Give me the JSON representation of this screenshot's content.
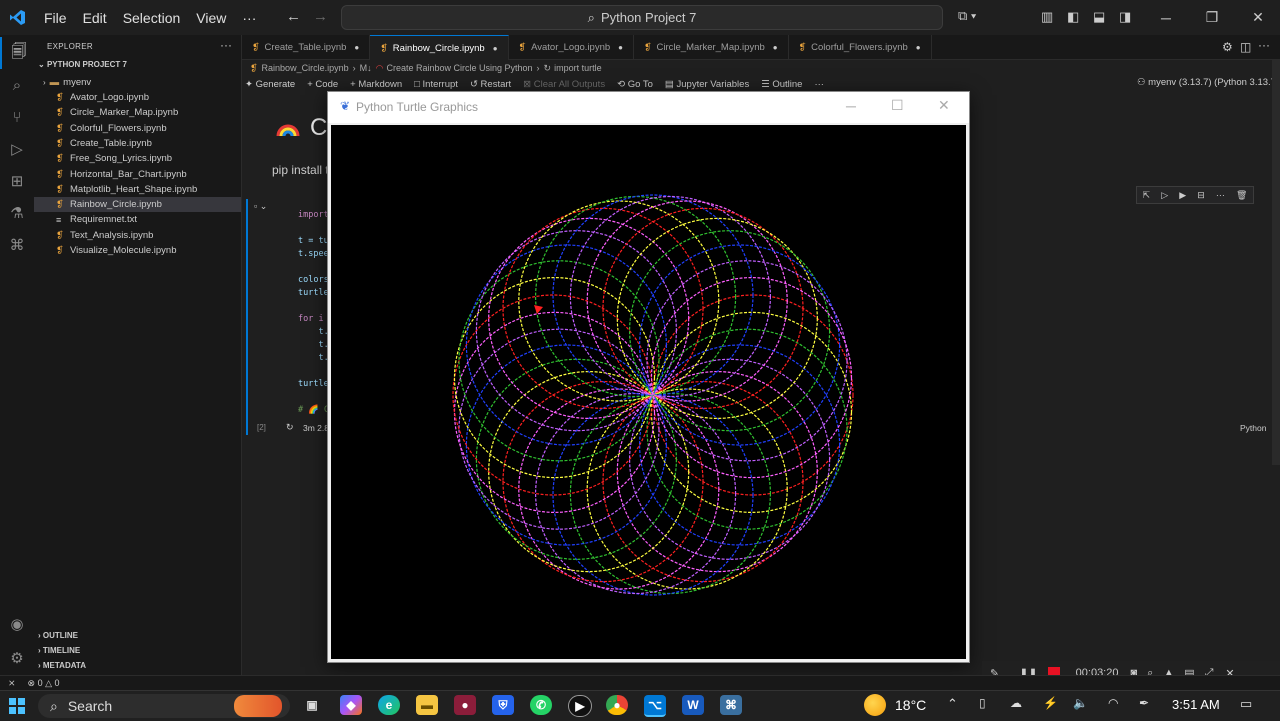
{
  "menu": [
    "File",
    "Edit",
    "Selection",
    "View",
    "···"
  ],
  "command_center": "Python Project 7",
  "sidebar": {
    "header": "EXPLORER",
    "project": "PYTHON PROJECT 7",
    "folder": "myenv",
    "files": [
      {
        "name": "Avator_Logo.ipynb",
        "type": "notebook"
      },
      {
        "name": "Circle_Marker_Map.ipynb",
        "type": "notebook"
      },
      {
        "name": "Colorful_Flowers.ipynb",
        "type": "notebook"
      },
      {
        "name": "Create_Table.ipynb",
        "type": "notebook"
      },
      {
        "name": "Free_Song_Lyrics.ipynb",
        "type": "notebook"
      },
      {
        "name": "Horizontal_Bar_Chart.ipynb",
        "type": "notebook"
      },
      {
        "name": "Matplotlib_Heart_Shape.ipynb",
        "type": "notebook"
      },
      {
        "name": "Rainbow_Circle.ipynb",
        "type": "notebook",
        "active": true
      },
      {
        "name": "Requiremnet.txt",
        "type": "text"
      },
      {
        "name": "Text_Analysis.ipynb",
        "type": "notebook"
      },
      {
        "name": "Visualize_Molecule.ipynb",
        "type": "notebook"
      }
    ],
    "outline": "OUTLINE",
    "timeline": "TIMELINE",
    "metadata": "METADATA"
  },
  "tabs": [
    {
      "label": "Create_Table.ipynb",
      "active": false
    },
    {
      "label": "Rainbow_Circle.ipynb",
      "active": true
    },
    {
      "label": "Avator_Logo.ipynb",
      "active": false
    },
    {
      "label": "Circle_Marker_Map.ipynb",
      "active": false
    },
    {
      "label": "Colorful_Flowers.ipynb",
      "active": false
    }
  ],
  "breadcrumb": {
    "file": "Rainbow_Circle.ipynb",
    "md": "M↓",
    "cell": "Create Rainbow Circle Using Python",
    "symbol": "import turtle"
  },
  "toolbar": {
    "generate": "Generate",
    "code": "Code",
    "markdown": "Markdown",
    "interrupt": "Interrupt",
    "restart": "Restart",
    "clear": "Clear All Outputs",
    "goto": "Go To",
    "variables": "Jupyter Variables",
    "outline": "Outline",
    "more": "···"
  },
  "kernel": "myenv (3.13.7) (Python 3.13.7)",
  "notebook": {
    "heading_partial": "Cr",
    "pip_partial": "pip install t",
    "code_lines": [
      "import",
      "",
      "t = tu",
      "t.spee",
      "",
      "colors",
      "turtle",
      "",
      "for i",
      "    t.",
      "    t.",
      "    t.",
      "",
      "turtle",
      "",
      "# 🌈 C"
    ],
    "exec_count": "[2]",
    "exec_time": "3m 2.8s",
    "language": "Python"
  },
  "turtle_window": {
    "title": "Python Turtle Graphics",
    "palette": [
      "#ff2020",
      "#ffff40",
      "#30c030",
      "#2040ff",
      "#c060ff",
      "#ff60ff"
    ]
  },
  "status": {
    "errors": "0",
    "warnings": "0"
  },
  "recorder": {
    "time": "00:03:20"
  },
  "taskbar": {
    "search": "Search",
    "temperature": "18°C",
    "time": "3:51 AM"
  }
}
